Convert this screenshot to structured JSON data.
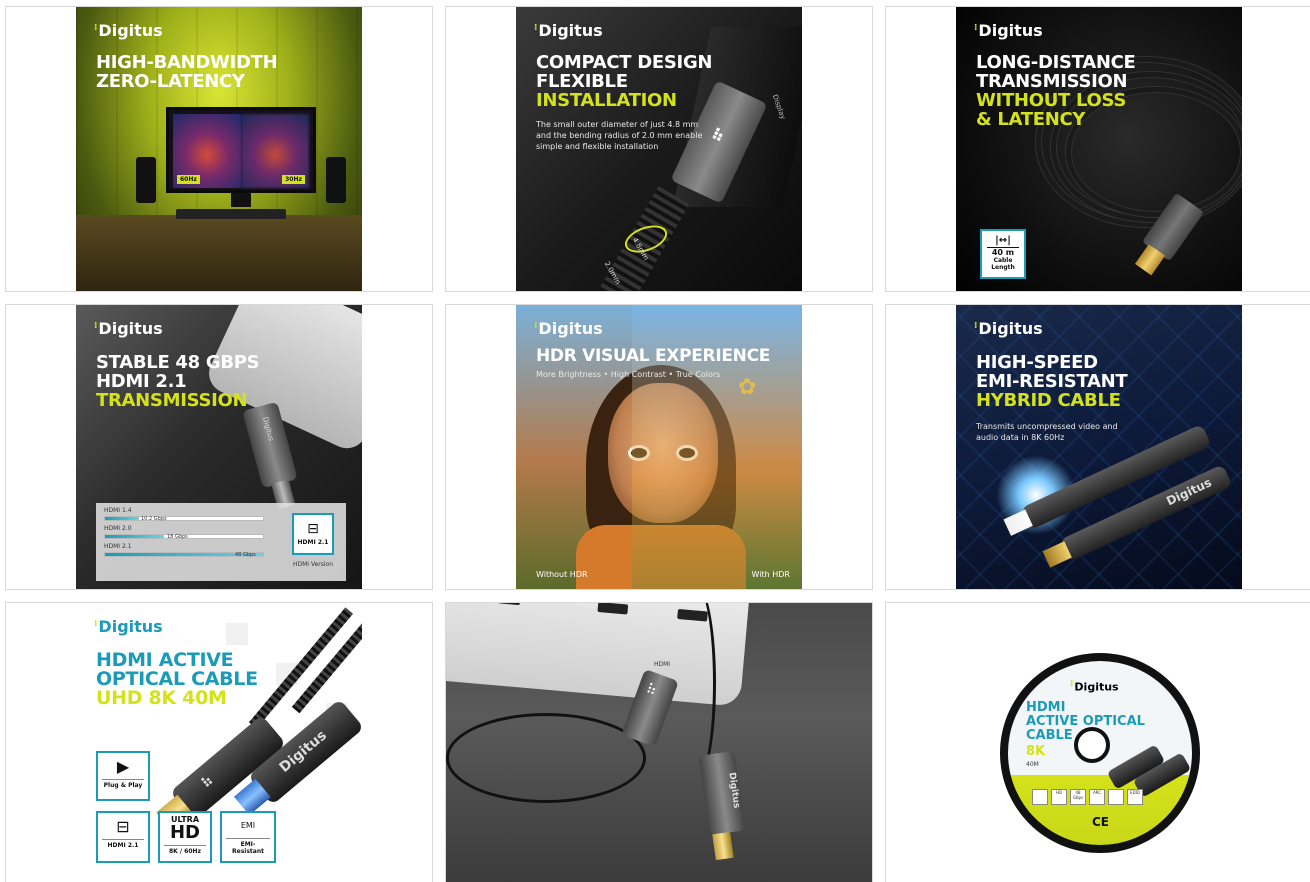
{
  "brand": {
    "name": "Digitus",
    "colors": {
      "teal": "#1a9bb8",
      "lime": "#d4e21a",
      "dark": "#111111"
    }
  },
  "tiles": [
    {
      "headline": [
        "HIGH-BANDWIDTH",
        "ZERO-LATENCY"
      ],
      "labels": {
        "left": "60Hz",
        "right": "30Hz"
      }
    },
    {
      "headline": [
        "COMPACT DESIGN",
        "FLEXIBLE"
      ],
      "headline_accent": [
        "INSTALLATION"
      ],
      "subtext": [
        "The small outer diameter of just 4.8 mm",
        "and the bending radius of 2.0 mm enable",
        "simple and flexible installation"
      ],
      "dims": {
        "diameter": "4.8mm",
        "radius": "2.0mm"
      },
      "connector_text": "Display"
    },
    {
      "headline": [
        "LONG-DISTANCE",
        "TRANSMISSION"
      ],
      "headline_accent": [
        "WITHOUT LOSS",
        "& LATENCY"
      ],
      "badge": {
        "icon": "|↔|",
        "length": "40 m",
        "caption": [
          "Cable",
          "Length"
        ]
      }
    },
    {
      "headline": [
        "STABLE 48 GBPS",
        "HDMI 2.1"
      ],
      "headline_accent": [
        "TRANSMISSION"
      ],
      "connector_text": "Digitus",
      "bars": [
        {
          "label": "HDMI 1.4",
          "value_text": "10.2 Gbps",
          "value": 10.2
        },
        {
          "label": "HDMI 2.0",
          "value_text": "18 Gbps",
          "value": 18
        },
        {
          "label": "HDMI 2.1",
          "value_text": "48 Gbps",
          "value": 48
        }
      ],
      "version_badge": {
        "label": "HDMI 2.1",
        "caption": "HDMI Version"
      }
    },
    {
      "headline": [
        "HDR VISUAL EXPERIENCE"
      ],
      "subtext": "More Brightness • High Contrast • True Colors",
      "left_caption": "Without HDR",
      "right_caption": "With HDR"
    },
    {
      "headline": [
        "HIGH-SPEED",
        "EMI-RESISTANT"
      ],
      "headline_accent": [
        "HYBRID CABLE"
      ],
      "subtext": [
        "Transmits uncompressed video and",
        "audio data in 8K 60Hz"
      ],
      "connector_text": "Digitus"
    },
    {
      "headline": [
        "HDMI ACTIVE",
        "OPTICAL CABLE"
      ],
      "headline_accent": [
        "UHD 8K 40M"
      ],
      "connector_text": "Digitus",
      "badges": {
        "plug": "Plug & Play",
        "hdmi": "HDMI 2.1",
        "uhd_top": "ULTRA",
        "uhd_big": "HD",
        "uhd_sub": "8K / 60Hz",
        "emi_icon": "EMI",
        "emi": "EMI-Resistant"
      }
    },
    {
      "connector_text": "Digitus",
      "port_label": "HDMI"
    },
    {
      "spool_text": [
        "HDMI",
        "ACTIVE OPTICAL",
        "CABLE"
      ],
      "spool_accent": "8K",
      "spool_length": "40M",
      "icons": [
        "",
        "HD",
        "48 Gbps",
        "ARC",
        "",
        "EDID"
      ],
      "ce": "CE"
    }
  ]
}
